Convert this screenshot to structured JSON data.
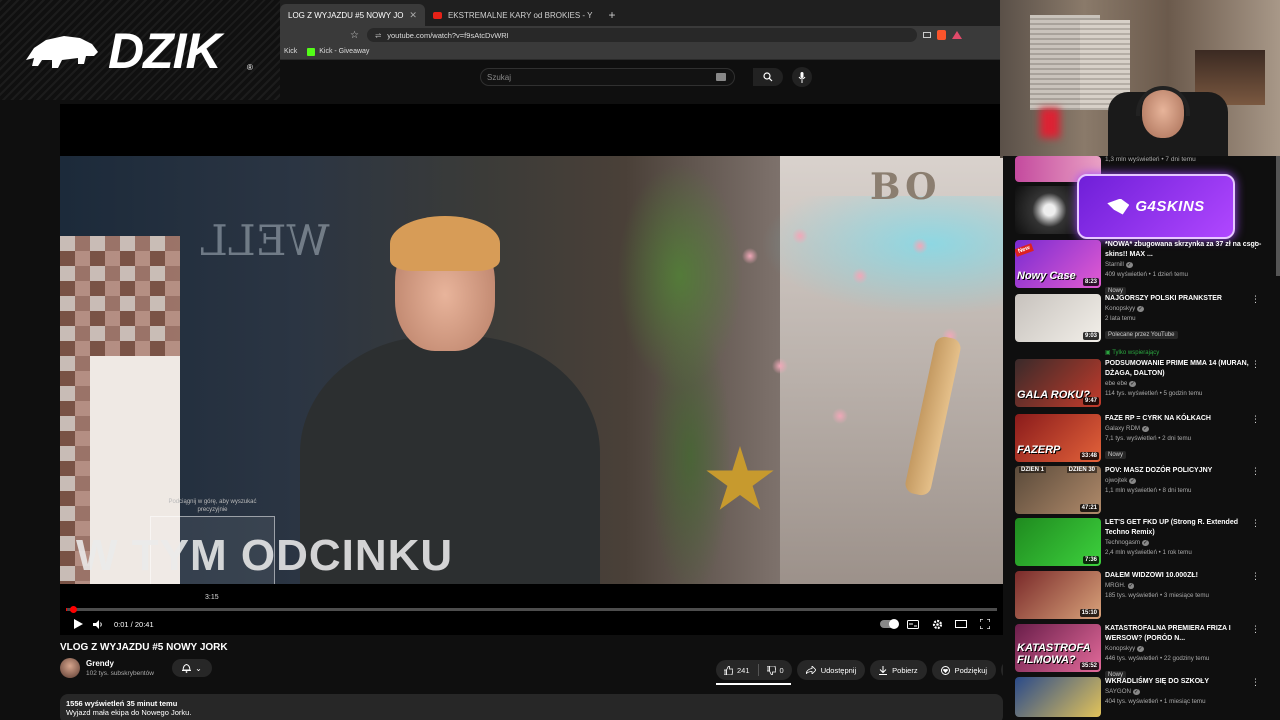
{
  "logo": {
    "text": "DZIK",
    "reg": "®"
  },
  "browser": {
    "tabs": [
      {
        "label": "LOG Z WYJAZDU #5 NOWY JO",
        "active": true
      },
      {
        "label": "EKSTREMALNE KARY od BROKIES - Y",
        "active": false
      }
    ],
    "new_tab": "+",
    "url": "youtube.com/watch?v=f9sAtcDvWRI",
    "bookmarks": [
      "Kick",
      "Kick - Giveaway"
    ]
  },
  "youtube": {
    "search_placeholder": "Szukaj"
  },
  "video": {
    "overlay_title": "W TYM ODCINKU",
    "seek_hint": "Podciągnij w górę, aby wyszukać precyzyjnie",
    "hover_time": "3:15",
    "timecode": "0:01 / 20:41",
    "progress_fraction": 0.001
  },
  "info": {
    "title": "VLOG Z WYJAZDU #5 NOWY JORK",
    "channel": "Grendy",
    "subs": "102 tys. subskrybentów",
    "likes": "241",
    "dislikes": "0",
    "share": "Udostępnij",
    "download": "Pobierz",
    "thanks": "Podziękuj",
    "stats": "1556 wyświetleń  35 minut temu",
    "description": "Wyjazd mała ekipa do Nowego Jorku."
  },
  "sponsor": {
    "text": "G4SKINS"
  },
  "sidebar": {
    "top_meta": "1,3 mln wyświetleń • 7 dni temu",
    "items": [
      {
        "title": "*NOWA* zbugowana skrzynka za 37 zł na csgo-skins!! MAX ...",
        "channel": "Starnill",
        "meta": "409 wyświetleń • 1 dzień temu",
        "badge": "Nowy",
        "duration": "8:23",
        "caption": "Nowy Case",
        "new_tag": "New",
        "colors": [
          "#7a2bd1",
          "#e25bd1"
        ]
      },
      {
        "title": "NAJGORSZY POLSKI PRANKSTER",
        "channel": "Konopskyy",
        "meta": "2 lata temu",
        "extra1": "Polecane przez YouTube",
        "extra2": "Tylko wspierający",
        "duration": "9:03",
        "caption": "",
        "colors": [
          "#c7c2bd",
          "#f2efe9"
        ]
      },
      {
        "title": "PODSUMOWANIE PRIME MMA 14 (MURAN, DŻAGA, DALTON)",
        "channel": "ebe ebe",
        "meta": "114 tys. wyświetleń • 5 godzin temu",
        "duration": "9:47",
        "caption": "GALA ROKU?",
        "colors": [
          "#3a2a2a",
          "#c23b2b"
        ]
      },
      {
        "title": "FAZE RP = CYRK NA KÓŁKACH",
        "channel": "Galaxy RDM",
        "meta": "7,1 tys. wyświetleń • 2 dni temu",
        "badge": "Nowy",
        "duration": "33:48",
        "caption": "FAZERP",
        "colors": [
          "#8a1b1b",
          "#e3623a"
        ]
      },
      {
        "title": "POV: MASZ DOZÓR POLICYJNY",
        "channel": "ojwojtek",
        "meta": "1,1 mln wyświetleń • 8 dni temu",
        "duration": "47:21",
        "caption": "",
        "colors": [
          "#5a4a3a",
          "#b08a6a"
        ],
        "labels": [
          "DZIEŃ 1",
          "DZIEŃ 30"
        ]
      },
      {
        "title": "LET'S GET FKD UP (Strong R. Extended Techno Remix)",
        "channel": "Technogasm",
        "meta": "2,4 mln wyświetleń • 1 rok temu",
        "duration": "7:36",
        "caption": "",
        "colors": [
          "#1f8a1f",
          "#3dd13d"
        ]
      },
      {
        "title": "DAŁEM WIDZOWI 10.000ZŁ!",
        "channel": "MRGH.",
        "meta": "185 tys. wyświetleń • 3 miesiące temu",
        "duration": "15:10",
        "caption": "",
        "colors": [
          "#7a2a2a",
          "#d8a27a"
        ]
      },
      {
        "title": "KATASTROFALNA PREMIERA FRIZA I WERSOW? (PORÓD N...",
        "channel": "Konopskyy",
        "meta": "446 tys. wyświetleń • 22 godziny temu",
        "badge": "Nowy",
        "duration": "35:52",
        "caption": "KATASTROFA FILMOWA?",
        "colors": [
          "#6a1e4a",
          "#e26a9a"
        ]
      },
      {
        "title": "WKRADLIŚMY SIĘ DO SZKOŁY",
        "channel": "SAYGON",
        "meta": "404 tys. wyświetleń • 1 miesiąc temu",
        "duration": "",
        "caption": "",
        "colors": [
          "#2a4a8a",
          "#e2c35a"
        ]
      }
    ]
  }
}
